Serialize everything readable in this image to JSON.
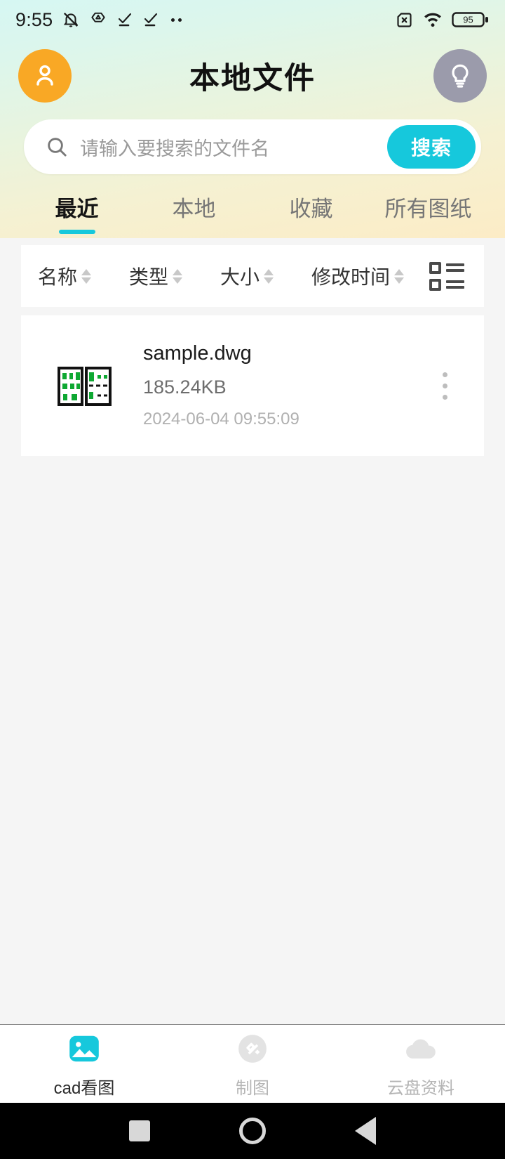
{
  "status_bar": {
    "time": "9:55",
    "battery_percent": "95",
    "icons": [
      "silent-bell-icon",
      "triangle-app-icon",
      "checkmark-icon",
      "checkmark-icon",
      "more-dots-icon",
      "no-sim-icon",
      "wifi-icon",
      "battery-icon"
    ]
  },
  "header": {
    "title": "本地文件",
    "avatar_icon": "person-icon",
    "bulb_icon": "lightbulb-icon",
    "avatar_color": "#f9a825",
    "bulb_color": "#9b9bab"
  },
  "search": {
    "placeholder": "请输入要搜索的文件名",
    "value": "",
    "button_label": "搜索",
    "button_color": "#16c8dc",
    "icon": "search-icon"
  },
  "tabs": {
    "active_index": 0,
    "accent_color": "#16c8dc",
    "items": [
      {
        "label": "最近"
      },
      {
        "label": "本地"
      },
      {
        "label": "收藏"
      },
      {
        "label": "所有图纸"
      }
    ]
  },
  "sort_bar": {
    "columns": [
      {
        "label": "名称"
      },
      {
        "label": "类型"
      },
      {
        "label": "大小"
      },
      {
        "label": "修改时间"
      }
    ],
    "view_toggle_icon": "list-view-icon"
  },
  "files": [
    {
      "name": "sample.dwg",
      "size": "185.24KB",
      "date": "2024-06-04 09:55:09",
      "thumbnail_icon": "cad-drawing-thumbnail",
      "menu_icon": "kebab-menu-icon"
    }
  ],
  "bottom_nav": {
    "active_index": 0,
    "active_color": "#16c8dc",
    "items": [
      {
        "label": "cad看图",
        "icon": "image-icon"
      },
      {
        "label": "制图",
        "icon": "drafting-icon"
      },
      {
        "label": "云盘资料",
        "icon": "cloud-icon"
      }
    ]
  },
  "system_bar": {
    "buttons": [
      "recents-square-button",
      "home-circle-button",
      "back-triangle-button"
    ]
  }
}
